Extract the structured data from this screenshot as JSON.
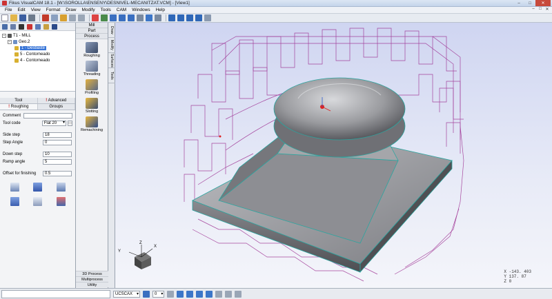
{
  "window": {
    "title": "Fikus VisualCAM 18.1 - [W:\\SOROLLA\\ENSENY\\DESNIVEL-MECANITZAT.VCM] - [View1]",
    "minimize": "–",
    "maximize": "□",
    "close": "✕"
  },
  "menu": {
    "items": [
      "File",
      "Edit",
      "View",
      "Format",
      "Draw",
      "Modify",
      "Tools",
      "CAM",
      "Windows",
      "Help"
    ],
    "mdi": [
      "–",
      "□",
      "✕"
    ]
  },
  "tree": {
    "root": "T1 - MILL",
    "group": "Geo.2",
    "ops": [
      "1 - Desbaste",
      "5 - Contorneado",
      "4 - Contorneado"
    ]
  },
  "tabs": {
    "tool": "Tool",
    "advanced": "Advanced",
    "roughing": "Roughing",
    "groups": "Groups",
    "mark": "!"
  },
  "form": {
    "comment_label": "Comment",
    "comment_value": "",
    "tool_code_label": "Tool code",
    "tool_code_value": "Flat 20",
    "dots": "...",
    "side_step_label": "Side step",
    "side_step_value": "18",
    "step_angle_label": "Step Angle",
    "step_angle_value": "0",
    "down_step_label": "Down step",
    "down_step_value": "10",
    "ramp_angle_label": "Ramp angle",
    "ramp_angle_value": "5",
    "offset_label": "Offset for finishing",
    "offset_value": "0.5"
  },
  "process": {
    "head_mill": "Mill",
    "head_part": "Part",
    "head_process": "Process",
    "items": [
      "Roughing",
      "Threading",
      "Profiling",
      "Slotting",
      "Remachining"
    ],
    "foot": [
      "3D Process",
      "Multiprocess",
      "Utility"
    ]
  },
  "vtabs": [
    "Draw",
    "Modify",
    "Surfaces",
    "Tools"
  ],
  "viewport": {
    "axis_x": "X",
    "axis_y": "Y",
    "axis_z": "Z",
    "coord_x": "X -143. 403",
    "coord_y": "Y 137. 87",
    "coord_z": "Z 0"
  },
  "statusbar": {
    "ucs": "UCSCAX",
    "layer": "0"
  },
  "colors": {
    "toolpath": "#9b2a8f",
    "edge": "#2aa6a0",
    "block_top": "#8a8b8f",
    "block_side": "#5e5f63"
  }
}
